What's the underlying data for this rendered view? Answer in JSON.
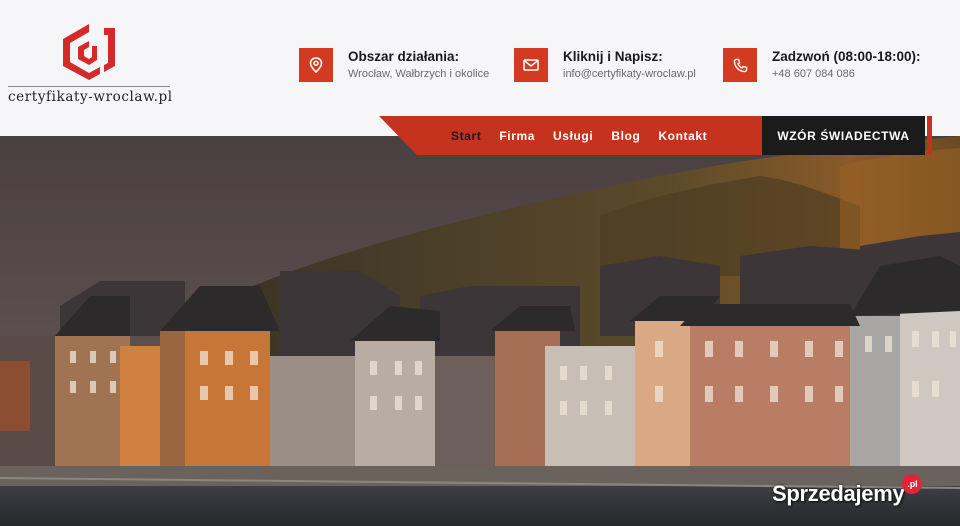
{
  "brand": {
    "name": "certyfikaty-wroclaw.pl",
    "logo_color": "#d42a2a"
  },
  "contacts": [
    {
      "icon": "map-pin-icon",
      "title": "Obszar działania:",
      "subtitle": "Wrocław, Wałbrzych i okolice"
    },
    {
      "icon": "envelope-icon",
      "title": "Kliknij i Napisz:",
      "subtitle": "info@certyfikaty-wroclaw.pl"
    },
    {
      "icon": "phone-icon",
      "title": "Zadzwoń (08:00-18:00):",
      "subtitle": "+48 607 084 086"
    }
  ],
  "nav": {
    "items": [
      "Start",
      "Firma",
      "Usługi",
      "Blog",
      "Kontakt"
    ],
    "active": "Start",
    "cta": "WZÓR ŚWIADECTWA"
  },
  "colors": {
    "accent": "#c5331f",
    "dark": "#1b1b1b",
    "topbar_bg": "#f6f6f8"
  },
  "hero": {
    "description": "Photograph of colorful riverside townhouses beneath a wooded autumn hill at dusk"
  },
  "watermark": {
    "text": "Sprzedajemy",
    "badge": ".pl"
  }
}
